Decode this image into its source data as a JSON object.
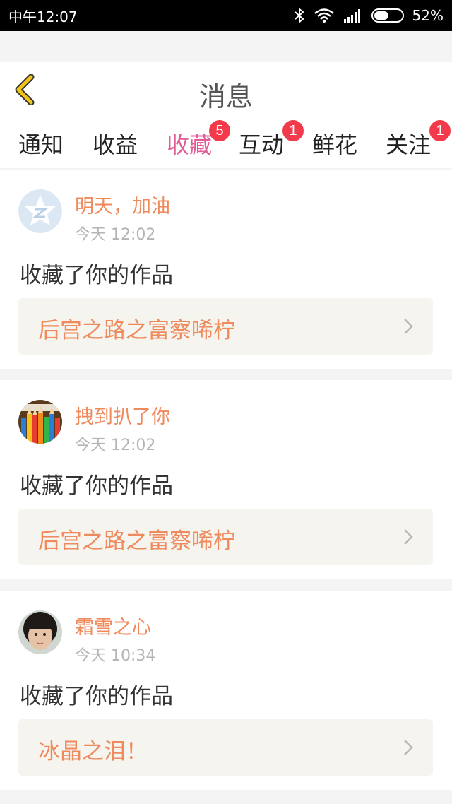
{
  "status_bar": {
    "time": "中午12:07",
    "battery_text": "52%",
    "icons": [
      "bluetooth-icon",
      "wifi-icon",
      "signal-icon",
      "battery-icon"
    ]
  },
  "header": {
    "title": "消息",
    "back_icon": "chevron-left-icon"
  },
  "tabs": [
    {
      "label": "通知",
      "badge": ""
    },
    {
      "label": "收益",
      "badge": ""
    },
    {
      "label": "收藏",
      "badge": "5",
      "active": true
    },
    {
      "label": "互动",
      "badge": "1"
    },
    {
      "label": "鲜花",
      "badge": ""
    },
    {
      "label": "关注",
      "badge": "1"
    }
  ],
  "messages": [
    {
      "username": "明天，加油",
      "time": "今天 12:02",
      "action": "收藏了你的作品",
      "work_title": "后宫之路之富察唏柠",
      "avatar": "default-star-avatar"
    },
    {
      "username": "拽到扒了你",
      "time": "今天 12:02",
      "action": "收藏了你的作品",
      "work_title": "后宫之路之富察唏柠",
      "avatar": "colored-pencils-avatar"
    },
    {
      "username": "霜雪之心",
      "time": "今天 10:34",
      "action": "收藏了你的作品",
      "work_title": "冰晶之泪！",
      "avatar": "child-photo-avatar"
    }
  ],
  "colors": {
    "accent_pink": "#e05d98",
    "username_orange": "#ef8a5c",
    "badge_red": "#f23a4c",
    "back_yellow": "#f0c419"
  }
}
